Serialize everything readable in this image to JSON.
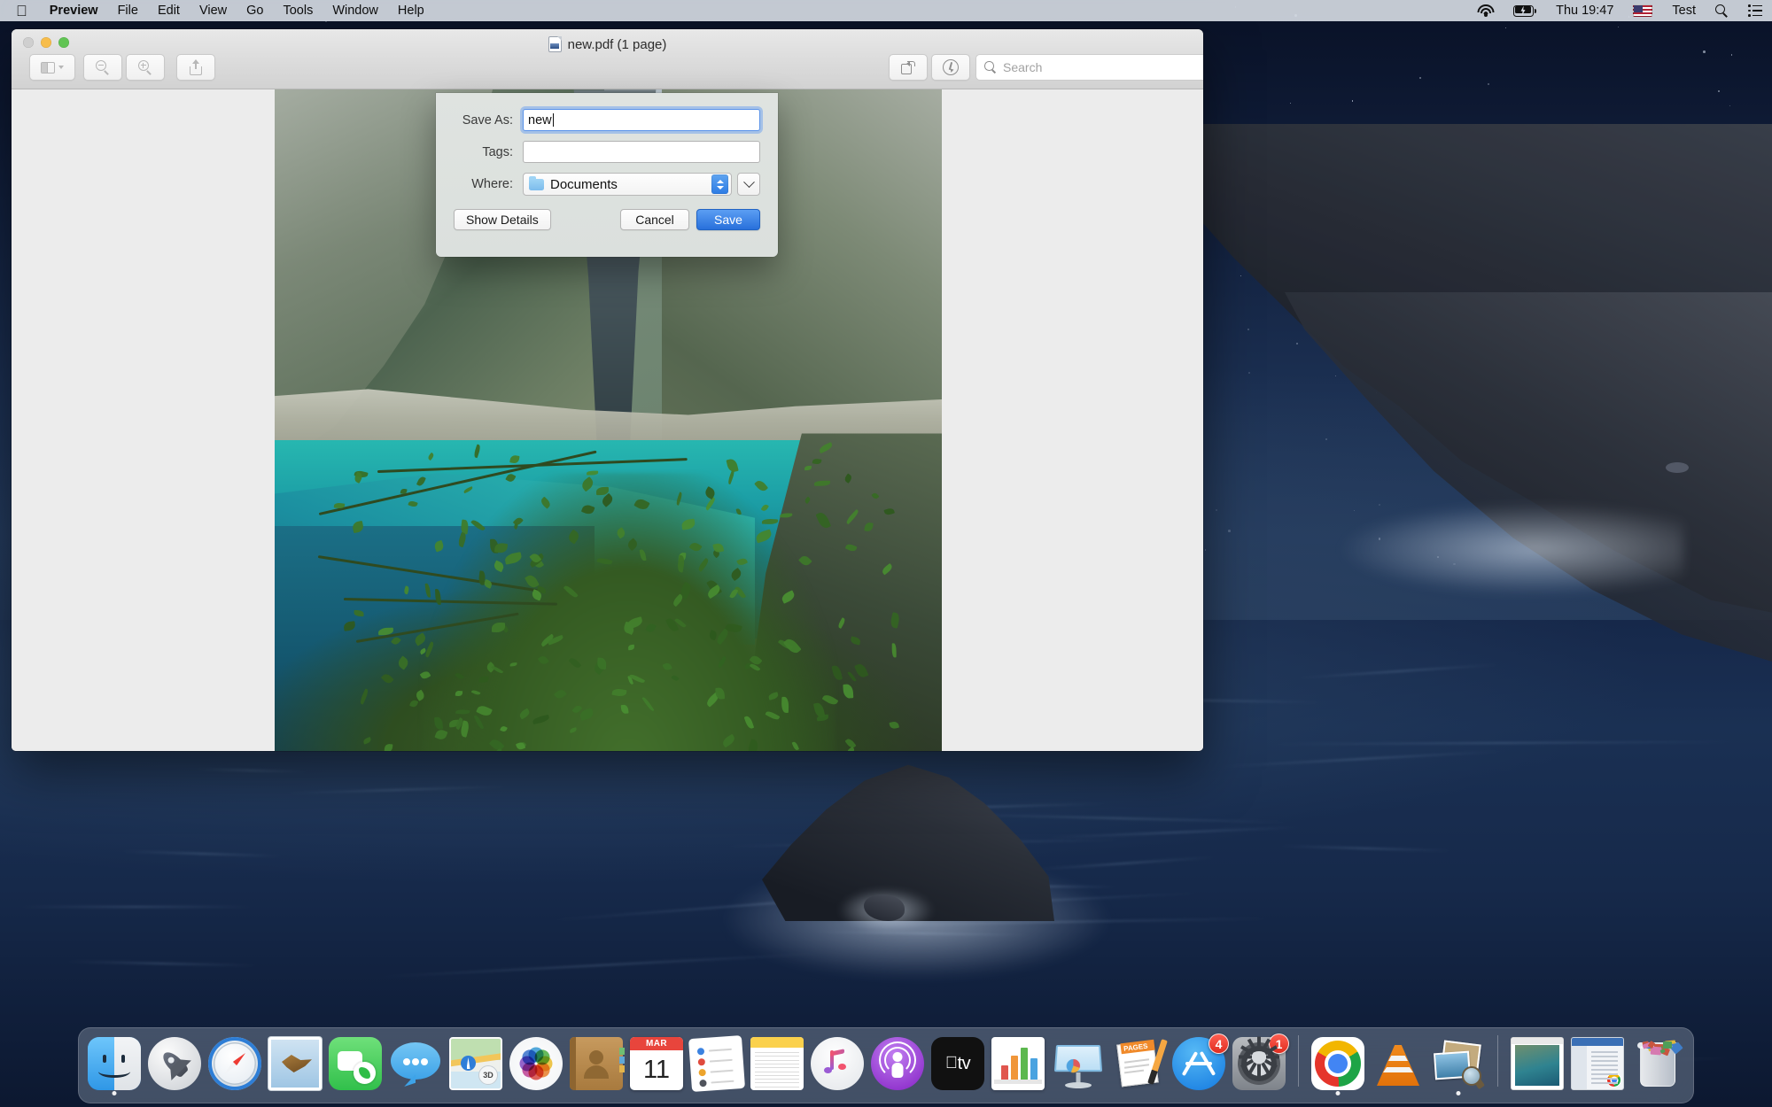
{
  "menubar": {
    "apple_icon": "apple-logo-icon",
    "items": [
      {
        "label": "Preview",
        "bold": true
      },
      {
        "label": "File",
        "bold": false
      },
      {
        "label": "Edit",
        "bold": false
      },
      {
        "label": "View",
        "bold": false
      },
      {
        "label": "Go",
        "bold": false
      },
      {
        "label": "Tools",
        "bold": false
      },
      {
        "label": "Window",
        "bold": false
      },
      {
        "label": "Help",
        "bold": false
      }
    ],
    "status": {
      "wifi_icon": "wifi-icon",
      "battery_icon": "battery-charging-icon",
      "clock": "Thu 19:47",
      "flag_icon": "us-flag-icon",
      "user": "Test",
      "search_icon": "spotlight-search-icon",
      "control_center_icon": "control-center-icon"
    }
  },
  "window": {
    "title": "new.pdf (1 page)",
    "doc_icon": "pdf-document-icon",
    "traffic_lights": {
      "close": "close-button",
      "minimize": "minimize-button",
      "maximize": "maximize-button"
    },
    "toolbar": {
      "sidebar_icon": "sidebar-toggle-icon",
      "sidebar_chevron_icon": "chevron-down-icon",
      "zoom_out_icon": "zoom-out-icon",
      "zoom_in_icon": "zoom-in-icon",
      "share_icon": "share-icon",
      "rotate_icon": "rotate-left-icon",
      "markup_icon": "markup-pen-icon",
      "search_icon": "search-icon",
      "search_value": "",
      "search_placeholder": "Search"
    }
  },
  "save_sheet": {
    "fields": [
      {
        "label": "Save As:",
        "value": "new",
        "placeholder": "",
        "focused": true
      },
      {
        "label": "Tags:",
        "value": "",
        "placeholder": "",
        "focused": false
      }
    ],
    "where": {
      "label": "Where:",
      "value": "Documents",
      "folder_icon": "folder-icon",
      "stepper_icon": "stepper-up-down-icon",
      "expand_icon": "chevron-down-icon"
    },
    "buttons": {
      "details": "Show Details",
      "cancel": "Cancel",
      "save": "Save"
    },
    "accent_color": "#2870db"
  },
  "dock": {
    "items": [
      {
        "name": "finder",
        "label": "Finder",
        "running": true
      },
      {
        "name": "launchpad",
        "label": "Launchpad",
        "running": false
      },
      {
        "name": "safari",
        "label": "Safari",
        "running": false
      },
      {
        "name": "mail",
        "label": "Mail",
        "running": false
      },
      {
        "name": "facetime",
        "label": "FaceTime",
        "running": false
      },
      {
        "name": "messages",
        "label": "Messages",
        "running": false
      },
      {
        "name": "maps",
        "label": "Maps",
        "running": false,
        "badge_text": "3D"
      },
      {
        "name": "photos",
        "label": "Photos",
        "running": false
      },
      {
        "name": "contacts",
        "label": "Contacts",
        "running": false
      },
      {
        "name": "calendar",
        "label": "Calendar",
        "running": false,
        "month": "MAR",
        "day": "11"
      },
      {
        "name": "reminders",
        "label": "Reminders",
        "running": false
      },
      {
        "name": "notes",
        "label": "Notes",
        "running": false
      },
      {
        "name": "itunes",
        "label": "iTunes",
        "running": false
      },
      {
        "name": "podcasts",
        "label": "Podcasts",
        "running": false
      },
      {
        "name": "appletv",
        "label": "TV",
        "running": false,
        "glyph": "tv"
      },
      {
        "name": "numbers",
        "label": "Numbers",
        "running": false
      },
      {
        "name": "keynote",
        "label": "Keynote",
        "running": false
      },
      {
        "name": "pages",
        "label": "Pages",
        "running": false,
        "wordmark": "PAGES"
      },
      {
        "name": "app-store",
        "label": "App Store",
        "running": false,
        "badge": "4"
      },
      {
        "name": "system-preferences",
        "label": "System Preferences",
        "running": false,
        "badge": "1"
      },
      {
        "name": "chrome",
        "label": "Google Chrome",
        "running": true
      },
      {
        "name": "vlc",
        "label": "VLC",
        "running": false
      },
      {
        "name": "preview",
        "label": "Preview",
        "running": true
      },
      {
        "name": "minimized-window-document",
        "label": "new.pdf",
        "running": false
      },
      {
        "name": "minimized-window-browser",
        "label": "Chrome Window",
        "running": false
      },
      {
        "name": "trash",
        "label": "Trash",
        "running": false
      }
    ]
  },
  "desktop": {
    "wallpaper": "catalina-night-coast",
    "sky_color": "#17284a",
    "sea_color": "#16294a"
  }
}
